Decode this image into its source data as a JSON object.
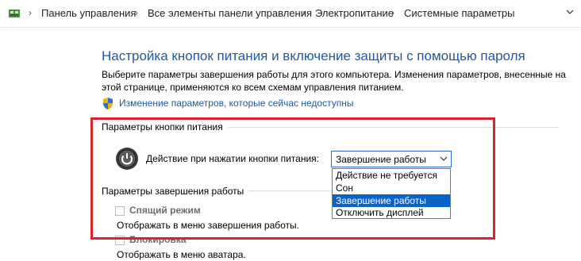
{
  "address_bar": {
    "crumbs": [
      "Панель управления",
      "Все элементы панели управления",
      "Электропитание",
      "Системные параметры"
    ]
  },
  "main": {
    "title": "Настройка кнопок питания и включение защиты с помощью пароля",
    "description": "Выберите параметры завершения работы для этого компьютера. Изменения параметров, внесенные на этой странице, применяются ко всем схемам управления питанием.",
    "admin_link": "Изменение параметров, которые сейчас недоступны"
  },
  "power_button": {
    "group_label": "Параметры кнопки питания",
    "action_label": "Действие при нажатии кнопки питания:",
    "selected": "Завершение работы",
    "options": [
      "Действие не требуется",
      "Сон",
      "Завершение работы",
      "Отключить дисплей"
    ]
  },
  "shutdown": {
    "group_label": "Параметры завершения работы",
    "items": [
      {
        "label": "Спящий режим",
        "sub": "Отображать в меню завершения работы."
      },
      {
        "label": "Блокировка",
        "sub": "Отображать в меню аватара."
      }
    ]
  },
  "colors": {
    "title_blue": "#1e5aa8",
    "highlight": "#0a64c8",
    "annotation_red": "#e0202a"
  }
}
